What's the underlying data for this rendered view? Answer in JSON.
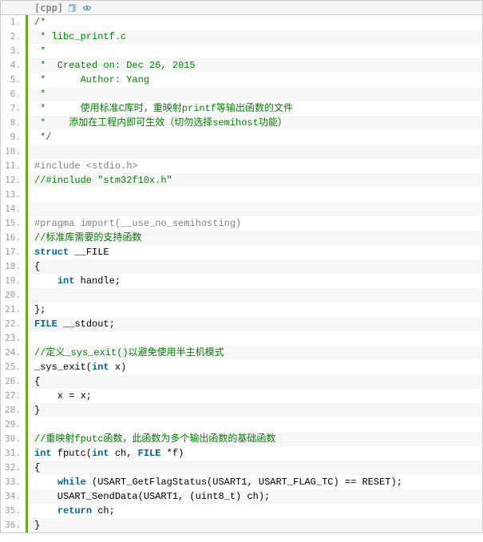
{
  "header": {
    "lang_label": "[cpp]",
    "copy_icon": "copy-icon",
    "view_icon": "view-icon"
  },
  "lines": [
    {
      "n": "1.",
      "segs": [
        {
          "cls": "tok-comment",
          "t": "/*"
        }
      ]
    },
    {
      "n": "2.",
      "segs": [
        {
          "cls": "tok-comment",
          "t": " * libc_printf.c"
        }
      ]
    },
    {
      "n": "3.",
      "segs": [
        {
          "cls": "tok-comment",
          "t": " *"
        }
      ]
    },
    {
      "n": "4.",
      "segs": [
        {
          "cls": "tok-comment",
          "t": " *  Created on: Dec 26, 2015"
        }
      ]
    },
    {
      "n": "5.",
      "segs": [
        {
          "cls": "tok-comment",
          "t": " *      Author: Yang"
        }
      ]
    },
    {
      "n": "6.",
      "segs": [
        {
          "cls": "tok-comment",
          "t": " *"
        }
      ]
    },
    {
      "n": "7.",
      "segs": [
        {
          "cls": "tok-comment",
          "t": " *      使用标准C库时，重映射printf等输出函数的文件"
        }
      ]
    },
    {
      "n": "8.",
      "segs": [
        {
          "cls": "tok-comment",
          "t": " *    添加在工程内即可生效（切勿选择semihost功能）"
        }
      ]
    },
    {
      "n": "9.",
      "segs": [
        {
          "cls": "tok-comment",
          "t": " */"
        }
      ]
    },
    {
      "n": "10.",
      "segs": [
        {
          "cls": "tok-plain",
          "t": "  "
        }
      ]
    },
    {
      "n": "11.",
      "segs": [
        {
          "cls": "tok-pre",
          "t": "#include <stdio.h>"
        }
      ]
    },
    {
      "n": "12.",
      "segs": [
        {
          "cls": "tok-comment",
          "t": "//#include \"stm32f10x.h\""
        }
      ]
    },
    {
      "n": "13.",
      "segs": [
        {
          "cls": "tok-plain",
          "t": "  "
        }
      ]
    },
    {
      "n": "14.",
      "segs": [
        {
          "cls": "tok-plain",
          "t": "  "
        }
      ]
    },
    {
      "n": "15.",
      "segs": [
        {
          "cls": "tok-pre",
          "t": "#pragma import(__use_no_semihosting)"
        }
      ]
    },
    {
      "n": "16.",
      "segs": [
        {
          "cls": "tok-comment",
          "t": "//标准库需要的支持函数"
        }
      ]
    },
    {
      "n": "17.",
      "segs": [
        {
          "cls": "tok-kw",
          "t": "struct"
        },
        {
          "cls": "tok-plain",
          "t": " __FILE"
        }
      ]
    },
    {
      "n": "18.",
      "segs": [
        {
          "cls": "tok-plain",
          "t": "{"
        }
      ]
    },
    {
      "n": "19.",
      "segs": [
        {
          "cls": "tok-plain",
          "t": "    "
        },
        {
          "cls": "tok-kw",
          "t": "int"
        },
        {
          "cls": "tok-plain",
          "t": " handle;"
        }
      ]
    },
    {
      "n": "20.",
      "segs": [
        {
          "cls": "tok-plain",
          "t": "  "
        }
      ]
    },
    {
      "n": "21.",
      "segs": [
        {
          "cls": "tok-plain",
          "t": "};"
        }
      ]
    },
    {
      "n": "22.",
      "segs": [
        {
          "cls": "tok-kw",
          "t": "FILE"
        },
        {
          "cls": "tok-plain",
          "t": " __stdout;"
        }
      ]
    },
    {
      "n": "23.",
      "segs": [
        {
          "cls": "tok-plain",
          "t": "  "
        }
      ]
    },
    {
      "n": "24.",
      "segs": [
        {
          "cls": "tok-comment",
          "t": "//定义_sys_exit()以避免使用半主机模式"
        }
      ]
    },
    {
      "n": "25.",
      "segs": [
        {
          "cls": "tok-plain",
          "t": "_sys_exit("
        },
        {
          "cls": "tok-kw",
          "t": "int"
        },
        {
          "cls": "tok-plain",
          "t": " x)"
        }
      ]
    },
    {
      "n": "26.",
      "segs": [
        {
          "cls": "tok-plain",
          "t": "{"
        }
      ]
    },
    {
      "n": "27.",
      "segs": [
        {
          "cls": "tok-plain",
          "t": "    x = x;"
        }
      ]
    },
    {
      "n": "28.",
      "segs": [
        {
          "cls": "tok-plain",
          "t": "}"
        }
      ]
    },
    {
      "n": "29.",
      "segs": [
        {
          "cls": "tok-plain",
          "t": "  "
        }
      ]
    },
    {
      "n": "30.",
      "segs": [
        {
          "cls": "tok-comment",
          "t": "//重映射fputc函数，此函数为多个输出函数的基础函数"
        }
      ]
    },
    {
      "n": "31.",
      "segs": [
        {
          "cls": "tok-kw",
          "t": "int"
        },
        {
          "cls": "tok-plain",
          "t": " fputc("
        },
        {
          "cls": "tok-kw",
          "t": "int"
        },
        {
          "cls": "tok-plain",
          "t": " ch, "
        },
        {
          "cls": "tok-kw",
          "t": "FILE"
        },
        {
          "cls": "tok-plain",
          "t": " *f)"
        }
      ]
    },
    {
      "n": "32.",
      "segs": [
        {
          "cls": "tok-plain",
          "t": "{"
        }
      ]
    },
    {
      "n": "33.",
      "segs": [
        {
          "cls": "tok-plain",
          "t": "    "
        },
        {
          "cls": "tok-kw",
          "t": "while"
        },
        {
          "cls": "tok-plain",
          "t": " (USART_GetFlagStatus(USART1, USART_FLAG_TC) == RESET);"
        }
      ]
    },
    {
      "n": "34.",
      "segs": [
        {
          "cls": "tok-plain",
          "t": "    USART_SendData(USART1, (uint8_t) ch);"
        }
      ]
    },
    {
      "n": "35.",
      "segs": [
        {
          "cls": "tok-plain",
          "t": "    "
        },
        {
          "cls": "tok-kw",
          "t": "return"
        },
        {
          "cls": "tok-plain",
          "t": " ch;"
        }
      ]
    },
    {
      "n": "36.",
      "segs": [
        {
          "cls": "tok-plain",
          "t": "}"
        }
      ]
    }
  ]
}
